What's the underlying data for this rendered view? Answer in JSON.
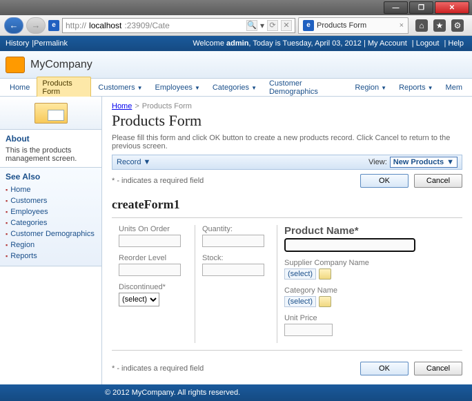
{
  "window": {
    "tab_title": "Products Form",
    "url_prefix": "http://",
    "url_host": "localhost",
    "url_rest": ":23909/Cate"
  },
  "appbar": {
    "history": "History",
    "permalink": "Permalink",
    "welcome_pre": "Welcome ",
    "welcome_user": "admin",
    "welcome_date": ", Today is Tuesday, April 03, 2012",
    "my_account": "My Account",
    "logout": "Logout",
    "help": "Help"
  },
  "header": {
    "company": "MyCompany"
  },
  "menu": {
    "items": [
      "Home",
      "Products Form",
      "Customers",
      "Employees",
      "Categories",
      "Customer Demographics",
      "Region",
      "Reports",
      "Mem"
    ],
    "active_index": 1,
    "has_dropdown": [
      false,
      false,
      true,
      true,
      true,
      false,
      true,
      true,
      false
    ]
  },
  "sidebar": {
    "about_title": "About",
    "about_text": "This is the products management screen.",
    "seealso_title": "See Also",
    "links": [
      "Home",
      "Customers",
      "Employees",
      "Categories",
      "Customer Demographics",
      "Region",
      "Reports"
    ]
  },
  "page": {
    "crumb_root": "Home",
    "crumb_current": "Products Form",
    "title": "Products Form",
    "description": "Please fill this form and click OK button to create a new products record. Click Cancel to return to the previous screen.",
    "record_label": "Record",
    "view_label": "View:",
    "view_value": "New Products",
    "required_note": "* - indicates a required field",
    "ok": "OK",
    "cancel": "Cancel",
    "form_title": "createForm1"
  },
  "form": {
    "col1": {
      "units_on_order": "Units On Order",
      "reorder_level": "Reorder Level",
      "discontinued": "Discontinued",
      "discontinued_required": "*",
      "discontinued_value": "(select)"
    },
    "col2": {
      "quantity": "Quantity:",
      "stock": "Stock:"
    },
    "col3": {
      "product_name": "Product Name",
      "product_name_required": "*",
      "supplier": "Supplier Company Name",
      "category": "Category Name",
      "unit_price": "Unit Price",
      "select_text": "(select)"
    }
  },
  "footer": {
    "copyright": "© 2012 MyCompany. All rights reserved."
  }
}
